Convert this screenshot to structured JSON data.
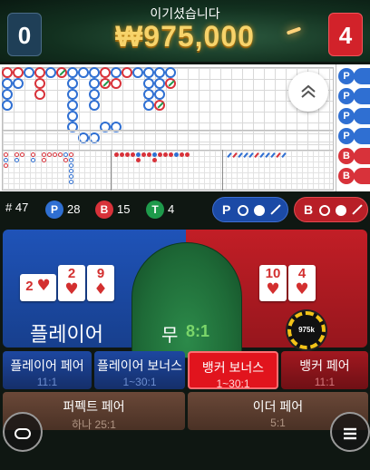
{
  "header": {
    "player_score": "0",
    "banker_score": "4",
    "result_title": "이기셨습니다",
    "win_amount": "₩975,000"
  },
  "roadmap": {
    "side_beads": [
      "P",
      "P",
      "P",
      "P",
      "B",
      "B"
    ],
    "collapse_icon": "chevron-double-up-icon"
  },
  "stats": {
    "total_label": "# 47",
    "player_letter": "P",
    "player_count": "28",
    "banker_letter": "B",
    "banker_count": "15",
    "tie_letter": "T",
    "tie_count": "4",
    "player_ask_letter": "P",
    "banker_ask_letter": "B"
  },
  "table": {
    "player_label": "플레이어",
    "tie_label": "무",
    "tie_odds": "8:1",
    "player_cards": [
      {
        "rank": "2",
        "suit": "♥",
        "side": true
      },
      {
        "rank": "2",
        "suit": "♥"
      },
      {
        "rank": "9",
        "suit": "♦"
      }
    ],
    "banker_cards": [
      {
        "rank": "10",
        "suit": "♥"
      },
      {
        "rank": "4",
        "suit": "♥"
      }
    ],
    "chip_value": "975k"
  },
  "side_bets": [
    {
      "name": "플레이어 페어",
      "odds": "11:1"
    },
    {
      "name": "플레이어 보너스",
      "odds": "1~30:1"
    },
    {
      "name": "뱅커 보너스",
      "odds": "1~30:1"
    },
    {
      "name": "뱅커 페어",
      "odds": "11:1"
    },
    {
      "name": "퍼펙트 페어",
      "odds": "하나 25:1"
    },
    {
      "name": "이더 페어",
      "odds": "5:1"
    }
  ],
  "colors": {
    "player_blue": "#1f53b8",
    "banker_red": "#c21e26",
    "tie_green": "#2c8a4a",
    "gold": "#f7d36a"
  },
  "icons": {
    "left_round_button": "chat-icon",
    "right_round_button": "menu-icon"
  }
}
